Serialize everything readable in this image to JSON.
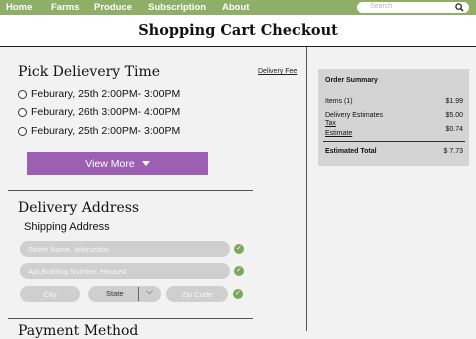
{
  "nav": {
    "items": [
      "Home",
      "Farms",
      "Produce",
      "Subscription",
      "About"
    ],
    "search_placeholder": "Search"
  },
  "page": {
    "title": "Shopping Cart Checkout"
  },
  "delivery_time": {
    "title": "Pick Delievery Time",
    "fee_link": "Delivery Fee",
    "options": [
      "Feburary, 25th 2:00PM- 3:00PM",
      "Feburary, 26th 3:00PM- 4:00PM",
      "Feburary, 25th 2:00PM- 3:00PM"
    ],
    "view_more": "View More"
  },
  "address": {
    "title": "Delivery Address",
    "subtitle": "Shipping Address",
    "street_placeholder": "Street Name, Intersetion",
    "apt_placeholder": "Apt,Building Number, House#",
    "city_placeholder": "City",
    "state_label": "State",
    "zip_placeholder": "Zip Code"
  },
  "payment": {
    "title": "Payment Method"
  },
  "summary": {
    "title": "Order Summary",
    "items_label": "Items (1)",
    "items_value": "$1.99",
    "delivery_label": "Delivery Estimates",
    "delivery_value": "$5.00",
    "tax_label": "Tax",
    "estimate_label": "Estimate",
    "tax_value": "$0.74",
    "total_label": "Estimated Total",
    "total_value": "$ 7.73"
  },
  "colors": {
    "nav": "#8fae68",
    "button": "#9d5fb2",
    "check": "#7da85a"
  }
}
